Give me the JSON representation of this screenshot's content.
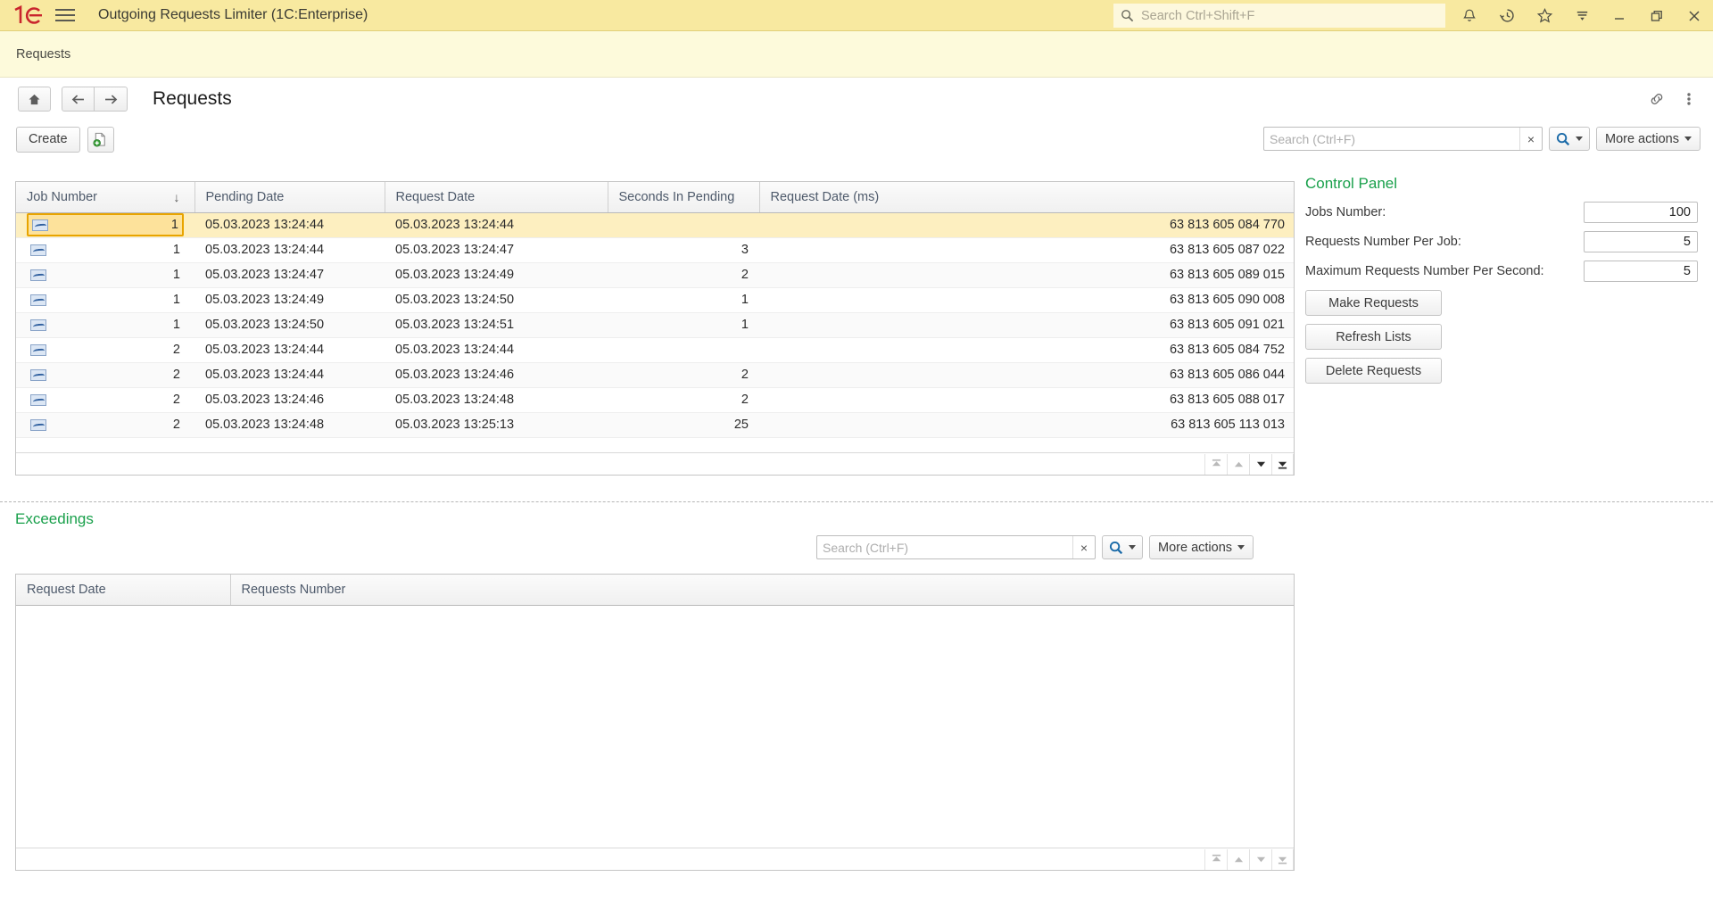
{
  "titlebar": {
    "app_title": "Outgoing Requests Limiter  (1C:Enterprise)",
    "logo": "1c-logo",
    "menu_icon": "hamburger-menu-icon",
    "search_placeholder": "Search Ctrl+Shift+F",
    "search_value": "",
    "icons": [
      {
        "name": "notifications-bell-icon",
        "glyph": "bell"
      },
      {
        "name": "history-clock-icon",
        "glyph": "history"
      },
      {
        "name": "favorites-star-icon",
        "glyph": "star"
      },
      {
        "name": "filter-icon",
        "glyph": "filter"
      }
    ],
    "window_controls": [
      {
        "name": "minimize-button",
        "glyph": "minimize"
      },
      {
        "name": "restore-button",
        "glyph": "restore"
      },
      {
        "name": "close-button",
        "glyph": "close"
      }
    ]
  },
  "breadcrumb": {
    "label": "Requests"
  },
  "form_header": {
    "home_icon": "home-icon",
    "back_icon": "back-arrow-icon",
    "forward_icon": "forward-arrow-icon",
    "title": "Requests",
    "link_icon": "link-icon",
    "more_menu_icon": "kebab-menu-icon"
  },
  "command_bar": {
    "create_label": "Create",
    "create_copy_icon": "create-new-document-icon",
    "search_placeholder": "Search (Ctrl+F)",
    "search_value": "",
    "clear_label": "×",
    "search_icon": "magnifier-icon",
    "more_actions_label": "More actions"
  },
  "requests_table": {
    "columns": [
      "Job Number",
      "Pending Date",
      "Request Date",
      "Seconds In Pending",
      "Request Date (ms)"
    ],
    "sort_column": "Job Number",
    "sort_direction": "↓",
    "row_icon": "record-chart-icon",
    "selected_row_index": 0,
    "rows": [
      {
        "job_number": "1",
        "pending_date": "05.03.2023 13:24:44",
        "request_date": "05.03.2023 13:24:44",
        "seconds_in_pending": "",
        "request_date_ms": "63 813 605 084 770"
      },
      {
        "job_number": "1",
        "pending_date": "05.03.2023 13:24:44",
        "request_date": "05.03.2023 13:24:47",
        "seconds_in_pending": "3",
        "request_date_ms": "63 813 605 087 022"
      },
      {
        "job_number": "1",
        "pending_date": "05.03.2023 13:24:47",
        "request_date": "05.03.2023 13:24:49",
        "seconds_in_pending": "2",
        "request_date_ms": "63 813 605 089 015"
      },
      {
        "job_number": "1",
        "pending_date": "05.03.2023 13:24:49",
        "request_date": "05.03.2023 13:24:50",
        "seconds_in_pending": "1",
        "request_date_ms": "63 813 605 090 008"
      },
      {
        "job_number": "1",
        "pending_date": "05.03.2023 13:24:50",
        "request_date": "05.03.2023 13:24:51",
        "seconds_in_pending": "1",
        "request_date_ms": "63 813 605 091 021"
      },
      {
        "job_number": "2",
        "pending_date": "05.03.2023 13:24:44",
        "request_date": "05.03.2023 13:24:44",
        "seconds_in_pending": "",
        "request_date_ms": "63 813 605 084 752"
      },
      {
        "job_number": "2",
        "pending_date": "05.03.2023 13:24:44",
        "request_date": "05.03.2023 13:24:46",
        "seconds_in_pending": "2",
        "request_date_ms": "63 813 605 086 044"
      },
      {
        "job_number": "2",
        "pending_date": "05.03.2023 13:24:46",
        "request_date": "05.03.2023 13:24:48",
        "seconds_in_pending": "2",
        "request_date_ms": "63 813 605 088 017"
      },
      {
        "job_number": "2",
        "pending_date": "05.03.2023 13:24:48",
        "request_date": "05.03.2023 13:25:13",
        "seconds_in_pending": "25",
        "request_date_ms": "63 813 605 113 013"
      }
    ],
    "nav": [
      {
        "name": "scroll-to-first-button",
        "glyph": "first",
        "enabled": false
      },
      {
        "name": "scroll-up-button",
        "glyph": "up",
        "enabled": false
      },
      {
        "name": "scroll-down-button",
        "glyph": "down",
        "enabled": true
      },
      {
        "name": "scroll-to-last-button",
        "glyph": "last",
        "enabled": true
      }
    ]
  },
  "control_panel": {
    "title": "Control Panel",
    "fields": [
      {
        "label": "Jobs Number:",
        "value": "100"
      },
      {
        "label": "Requests Number Per Job:",
        "value": "5"
      },
      {
        "label": "Maximum Requests Number Per Second:",
        "value": "5"
      }
    ],
    "buttons": [
      {
        "label": "Make Requests",
        "name": "make-requests-button"
      },
      {
        "label": "Refresh Lists",
        "name": "refresh-lists-button"
      },
      {
        "label": "Delete Requests",
        "name": "delete-requests-button"
      }
    ]
  },
  "exceedings": {
    "title": "Exceedings",
    "search_placeholder": "Search (Ctrl+F)",
    "search_value": "",
    "clear_label": "×",
    "search_icon": "magnifier-icon",
    "more_actions_label": "More actions",
    "columns": [
      "Request Date",
      "Requests Number"
    ],
    "rows": [],
    "nav": [
      {
        "name": "scroll-to-first-button",
        "glyph": "first",
        "enabled": false
      },
      {
        "name": "scroll-up-button",
        "glyph": "up",
        "enabled": false
      },
      {
        "name": "scroll-down-button",
        "glyph": "down",
        "enabled": false
      },
      {
        "name": "scroll-to-last-button",
        "glyph": "last",
        "enabled": false
      }
    ]
  },
  "colors": {
    "titlebar_bg": "#f8e9a0",
    "breadcrumb_bg": "#fdfadb",
    "accent_green": "#19a04b",
    "selection_yellow": "#fdefc0",
    "selection_border": "#e8a400",
    "logo_red": "#c9252d"
  }
}
